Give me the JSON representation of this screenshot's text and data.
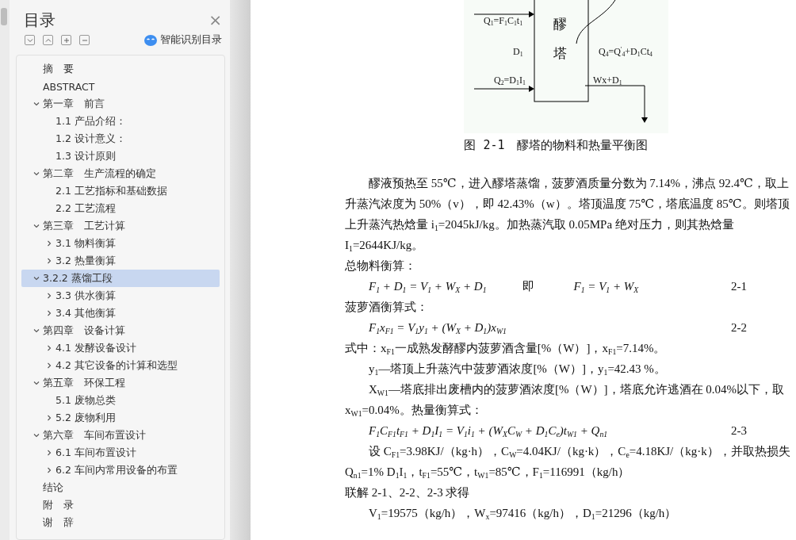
{
  "sidebar": {
    "title": "目录",
    "close": "×",
    "smart_toc": "智能识别目录",
    "items": [
      {
        "label": "摘　要",
        "selected": false
      },
      {
        "label": "ABSTRACT",
        "selected": false
      },
      {
        "label": "第一章　前言",
        "selected": false,
        "expanded": true,
        "children": [
          {
            "label": "1.1 产品介绍：",
            "selected": false
          },
          {
            "label": "1.2 设计意义：",
            "selected": false
          },
          {
            "label": "1.3  设计原则",
            "selected": false
          }
        ]
      },
      {
        "label": "第二章　生产流程的确定",
        "selected": false,
        "expanded": true,
        "children": [
          {
            "label": "2.1  工艺指标和基础数据",
            "selected": false
          },
          {
            "label": "2.2  工艺流程",
            "selected": false
          }
        ]
      },
      {
        "label": "第三章　工艺计算",
        "selected": false,
        "expanded": true,
        "children": [
          {
            "label": "3.1 物料衡算",
            "selected": false,
            "expanded": false
          },
          {
            "label": "3.2  热量衡算",
            "selected": false,
            "expanded": false
          }
        ]
      },
      {
        "label": "3.2.2  蒸馏工段",
        "selected": true,
        "expanded": true,
        "children": [
          {
            "label": "3.3  供水衡算",
            "selected": false,
            "expanded": false
          },
          {
            "label": "3.4  其他衡算",
            "selected": false,
            "expanded": false
          }
        ]
      },
      {
        "label": "第四章　设备计算",
        "selected": false,
        "expanded": true,
        "children": [
          {
            "label": "4.1 发酵设备设计",
            "selected": false,
            "expanded": false
          },
          {
            "label": "4.2 其它设备的计算和选型",
            "selected": false,
            "expanded": false
          }
        ]
      },
      {
        "label": "第五章　环保工程",
        "selected": false,
        "expanded": true,
        "children": [
          {
            "label": "5.1  废物总类",
            "selected": false
          },
          {
            "label": "5.2  废物利用",
            "selected": false,
            "expanded": false
          }
        ]
      },
      {
        "label": "第六章　车间布置设计",
        "selected": false,
        "expanded": true,
        "children": [
          {
            "label": "6.1 车间布置设计",
            "selected": false,
            "expanded": false
          },
          {
            "label": "6.2 车间内常用设备的布置",
            "selected": false,
            "expanded": false
          }
        ]
      },
      {
        "label": "结论",
        "selected": false
      },
      {
        "label": "附　录",
        "selected": false
      },
      {
        "label": "谢　辞",
        "selected": false
      }
    ]
  },
  "document": {
    "figure": {
      "q1": "Q$_{1}$=F$_{1}$C$_{1}$t$_{1}$",
      "tower_top": "醪",
      "d1": "D$_{1}$",
      "tower_bottom": "塔",
      "q4": "Q$_{4}$=Q$^{'}$$_{4}$+D$_{1}$Ct$_{4}$",
      "q2": "Q$_{2}$=D$_{1}$I$_{1}$",
      "output": "Wx+D$_{1}$",
      "caption": "图 2-1　醪塔的物料和热量平衡图"
    },
    "blocks": [
      {
        "kind": "para",
        "indent": true,
        "text": "醪液预热至 55℃，进入醪塔蒸馏，菠萝酒质量分数为 7.14%，沸点 92.4℃，取上升蒸汽浓度为 50%（v），即 42.43%（w）。塔顶温度 75℃，塔底温度 85℃。则塔顶上升蒸汽热焓量 i$_{1}$=2045kJ/kg。加热蒸汽取 0.05MPa 绝对压力，则其热焓量 I$_{1}$=2644KJ/kg。"
      },
      {
        "kind": "para",
        "indent": false,
        "text": "总物料衡算："
      },
      {
        "kind": "formula",
        "parts": [
          "F$_{1}$ + D$_{1}$ = V$_{1}$ + W$_{X}$ + D$_{1}$",
          "即",
          "F$_{1}$ = V$_{1}$ + W$_{X}$"
        ],
        "number": "2-1"
      },
      {
        "kind": "para",
        "indent": false,
        "text": "菠萝酒衡算式："
      },
      {
        "kind": "formula",
        "parts": [
          "F$_{1}$x$_{F1}$ = V$_{1}$y$_{1}$ + (W$_{X}$ + D$_{1}$)x$_{W1}$"
        ],
        "number": "2-2"
      },
      {
        "kind": "para",
        "indent": false,
        "text": "式中：x$_{F1}$一成熟发酵醪内菠萝酒含量[%（W）]，x$_{F1}$=7.14%。"
      },
      {
        "kind": "para",
        "indent": true,
        "text": "y$_{1}$—塔顶上升蒸汽中菠萝酒浓度[%（W）]，y$_{1}$=42.43 %。"
      },
      {
        "kind": "para",
        "indent": true,
        "text": "X$_{W1}$—塔底排出废槽内的菠萝酒浓度[%（W）]，塔底允许逃酒在 0.04%以下，取 x$_{W1}$=0.04%。热量衡算式："
      },
      {
        "kind": "formula",
        "parts": [
          "F$_{1}$C$_{F1}$t$_{F1}$ + D$_{1}$I$_{1}$ = V$_{1}$i$_{1}$ + (W$_{X}$C$_{W}$ + D$_{1}$C$_{e}$)t$_{W1}$ + Q$_{n1}$"
        ],
        "number": "2-3"
      },
      {
        "kind": "para",
        "indent": true,
        "text": "设 C$_{F1}$=3.98KJ/（kg·h），C$_{W}$=4.04KJ/（kg·k），C$_{e}$=4.18KJ/（kg·k），并取热损失 Q$_{n1}$=1% D$_{1}$I$_{1}$，t$_{F1}$=55℃，t$_{W1}$=85℃，F$_{1}$=116991（kg/h）"
      },
      {
        "kind": "para",
        "indent": false,
        "text": "联解 2-1、2-2、2-3 求得"
      },
      {
        "kind": "para",
        "indent": true,
        "text": "V$_{1}$=19575（kg/h），W$_{x}$=97416（kg/h），D$_{1}$=21296（kg/h）"
      }
    ]
  }
}
